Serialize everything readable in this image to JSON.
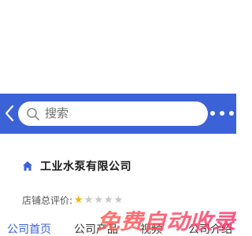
{
  "colors": {
    "header_bg": "#3c62d8",
    "accent": "#3c62d8",
    "star_filled": "#f5b301",
    "star_empty": "#c8c8c8",
    "watermark_start": "#ff5a4a",
    "watermark_end": "#ff2e6b"
  },
  "header": {
    "back_icon": "chevron-left-icon",
    "search": {
      "icon": "search-icon",
      "placeholder": "搜索"
    },
    "more_icon": "more-dots-icon"
  },
  "company": {
    "icon": "home-icon",
    "name": "工业水泵有限公司"
  },
  "rating": {
    "label": "店铺总评价:",
    "stars_filled": 1,
    "stars_total": 5
  },
  "nav": {
    "tabs": [
      {
        "label": "公司首页",
        "active": true
      },
      {
        "label": "公司产品",
        "active": false
      },
      {
        "label": "视频",
        "active": false
      },
      {
        "label": "公司介绍",
        "active": false
      }
    ]
  },
  "watermark": {
    "text": "免费自动收录"
  }
}
